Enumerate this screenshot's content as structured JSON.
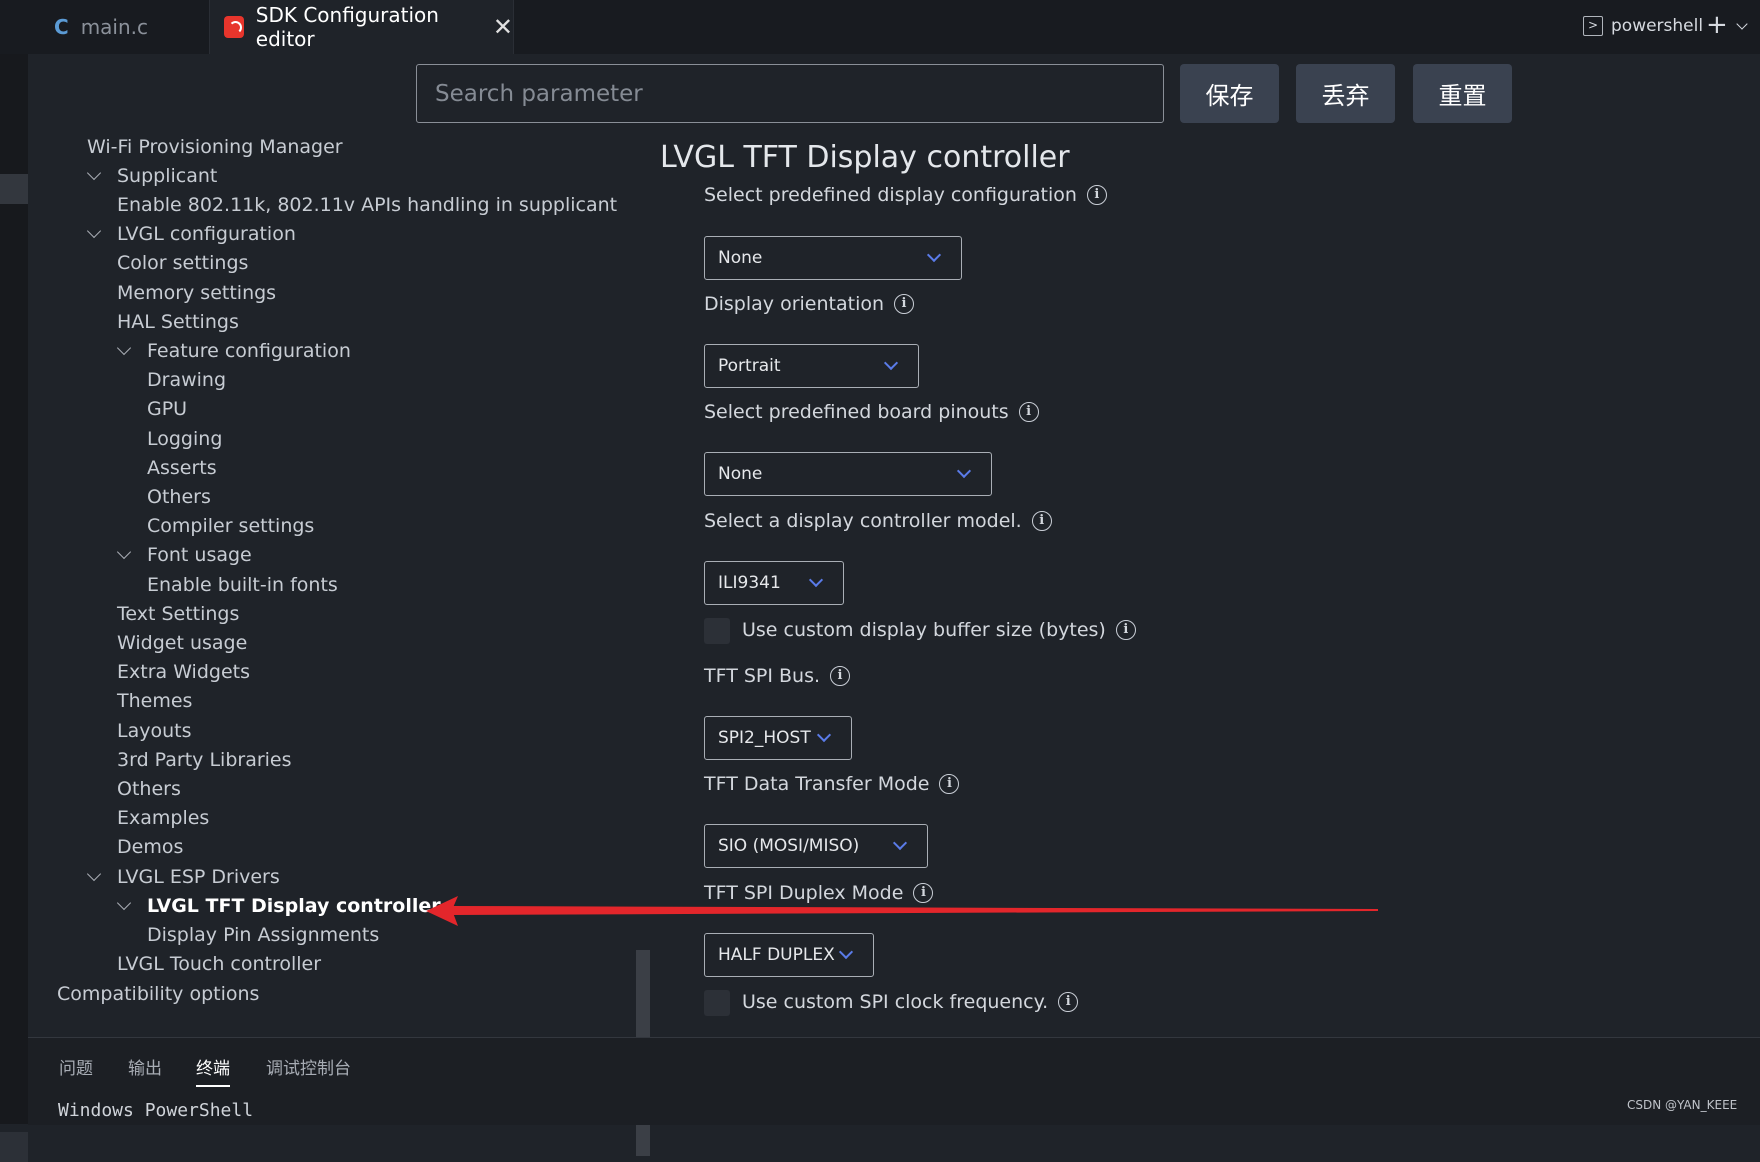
{
  "tabs": [
    {
      "label": "main.c",
      "icon": "c-file-icon"
    },
    {
      "label": "SDK Configuration editor",
      "icon": "espressif-icon",
      "close": "✕"
    }
  ],
  "search": {
    "placeholder": "Search parameter"
  },
  "actions": {
    "save": "保存",
    "discard": "丢弃",
    "reset": "重置"
  },
  "tree": [
    {
      "label": "Wi-Fi Provisioning Manager"
    },
    {
      "label": "Supplicant",
      "expanded": true
    },
    {
      "label": "Enable 802.11k, 802.11v APIs handling in supplicant"
    },
    {
      "label": "LVGL configuration",
      "expanded": true
    },
    {
      "label": "Color settings"
    },
    {
      "label": "Memory settings"
    },
    {
      "label": "HAL Settings"
    },
    {
      "label": "Feature configuration",
      "expanded": true
    },
    {
      "label": "Drawing"
    },
    {
      "label": "GPU"
    },
    {
      "label": "Logging"
    },
    {
      "label": "Asserts"
    },
    {
      "label": "Others"
    },
    {
      "label": "Compiler settings"
    },
    {
      "label": "Font usage",
      "expanded": true
    },
    {
      "label": "Enable built-in fonts"
    },
    {
      "label": "Text Settings"
    },
    {
      "label": "Widget usage"
    },
    {
      "label": "Extra Widgets"
    },
    {
      "label": "Themes"
    },
    {
      "label": "Layouts"
    },
    {
      "label": "3rd Party Libraries"
    },
    {
      "label": "Others"
    },
    {
      "label": "Examples"
    },
    {
      "label": "Demos"
    },
    {
      "label": "LVGL ESP Drivers",
      "expanded": true
    },
    {
      "label": "LVGL TFT Display controller",
      "expanded": true,
      "selected": true
    },
    {
      "label": "Display Pin Assignments"
    },
    {
      "label": "LVGL Touch controller"
    },
    {
      "label": "Compatibility options"
    }
  ],
  "panel": {
    "title": "LVGL TFT Display controller",
    "fields": [
      {
        "label": "Select predefined display configuration",
        "value": "None"
      },
      {
        "label": "Display orientation",
        "value": "Portrait"
      },
      {
        "label": "Select predefined board pinouts",
        "value": "None"
      },
      {
        "label": "Select a display controller model.",
        "value": "ILI9341"
      },
      {
        "label": "Use custom display buffer size (bytes)",
        "checked": false
      },
      {
        "label": "TFT SPI Bus.",
        "value": "SPI2_HOST"
      },
      {
        "label": "TFT Data Transfer Mode",
        "value": "SIO (MOSI/MISO)"
      },
      {
        "label": "TFT SPI Duplex Mode",
        "value": "HALF DUPLEX"
      },
      {
        "label": "Use custom SPI clock frequency.",
        "checked": false
      }
    ],
    "info_glyph": "i"
  },
  "bottom": {
    "tabs": [
      "问题",
      "输出",
      "终端",
      "调试控制台"
    ],
    "active_tab": "终端",
    "terminal_text": "Windows PowerShell",
    "shell": "powershell",
    "plus": "+"
  },
  "watermark": "CSDN @YAN_KEEE",
  "colors": {
    "accent": "#5a7be8",
    "arrow": "#e3262b",
    "button": "#3a4250"
  }
}
